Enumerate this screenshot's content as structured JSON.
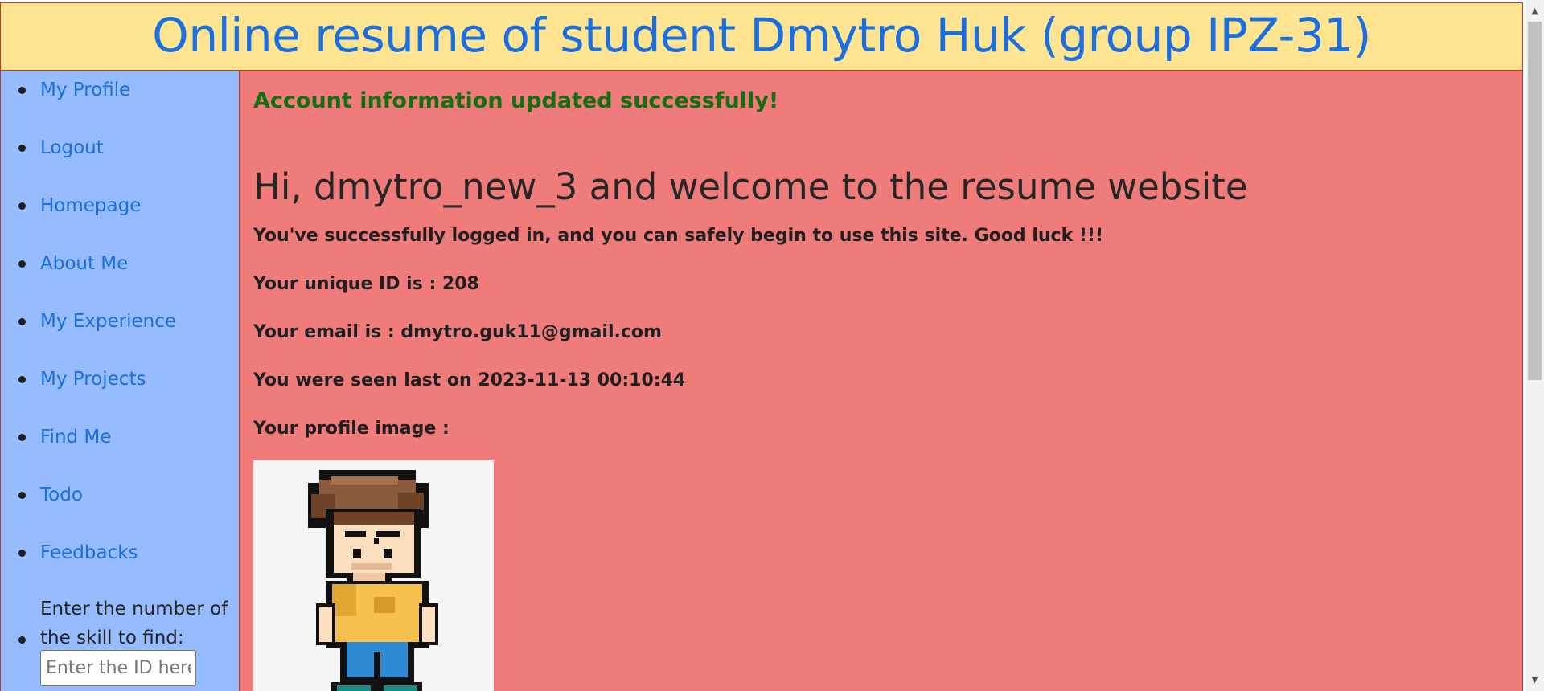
{
  "header": {
    "title": "Online resume of student Dmytro Huk (group IPZ-31)"
  },
  "sidebar": {
    "items": [
      {
        "label": "My Profile"
      },
      {
        "label": "Logout"
      },
      {
        "label": "Homepage"
      },
      {
        "label": "About Me"
      },
      {
        "label": "My Experience"
      },
      {
        "label": "My Projects"
      },
      {
        "label": "Find Me"
      },
      {
        "label": "Todo"
      },
      {
        "label": "Feedbacks"
      }
    ],
    "search": {
      "label": "Enter the number of the skill to find:",
      "placeholder": "Enter the ID here",
      "value": ""
    }
  },
  "main": {
    "success_message": "Account information updated successfully!",
    "welcome_heading": "Hi, dmytro_new_3 and welcome to the resume website",
    "info_lines": [
      "You've successfully logged in, and you can safely begin to use this site. Good luck !!!",
      "Your unique ID is : 208",
      "Your email is : dmytro.guk11@gmail.com",
      "You were seen last on 2023-11-13 00:10:44",
      "Your profile image :"
    ],
    "avatar_icon": "pixel-art-boy-avatar"
  },
  "colors": {
    "header_bg": "#ffe591",
    "title_text": "#1a6fe0",
    "sidebar_bg": "#96bbff",
    "main_bg": "#f07b7b",
    "success_text": "#127012",
    "border": "#c0392b"
  }
}
